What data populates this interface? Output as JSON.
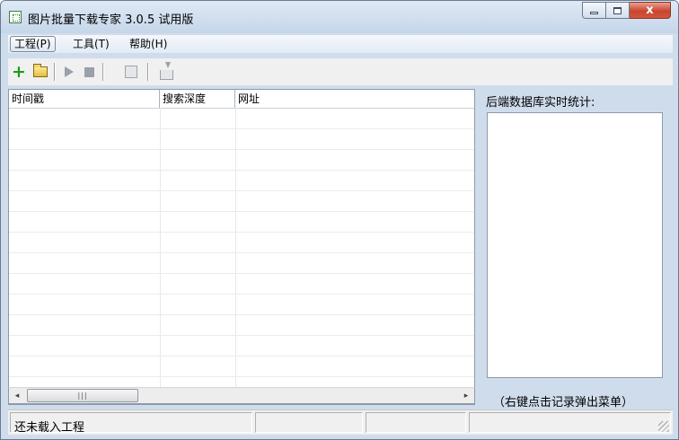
{
  "window": {
    "title": "图片批量下载专家 3.0.5 试用版",
    "close_glyph": "x"
  },
  "menu": [
    {
      "label": "工程(P)",
      "key": "P"
    },
    {
      "label": "工具(T)",
      "key": "T"
    },
    {
      "label": "帮助(H)",
      "key": "H"
    }
  ],
  "toolbar": {
    "add_glyph": "+",
    "icons": [
      "add-icon",
      "open-folder-icon",
      "play-icon",
      "stop-icon",
      "properties-icon",
      "export-icon"
    ]
  },
  "table": {
    "columns": [
      "时间戳",
      "搜索深度",
      "网址"
    ],
    "rows": []
  },
  "scrollbar": {
    "left_arrow": "◂",
    "right_arrow": "▸",
    "grip": "|||"
  },
  "stats": {
    "label": "后端数据库实时统计:",
    "hint": "（右键点击记录弹出菜单）"
  },
  "status": {
    "message": "还未载入工程",
    "panels": [
      "",
      "",
      "",
      ""
    ]
  },
  "colors": {
    "accent_green": "#1e9a1e",
    "close_red": "#c9452e",
    "chrome": "#cfdcec"
  }
}
